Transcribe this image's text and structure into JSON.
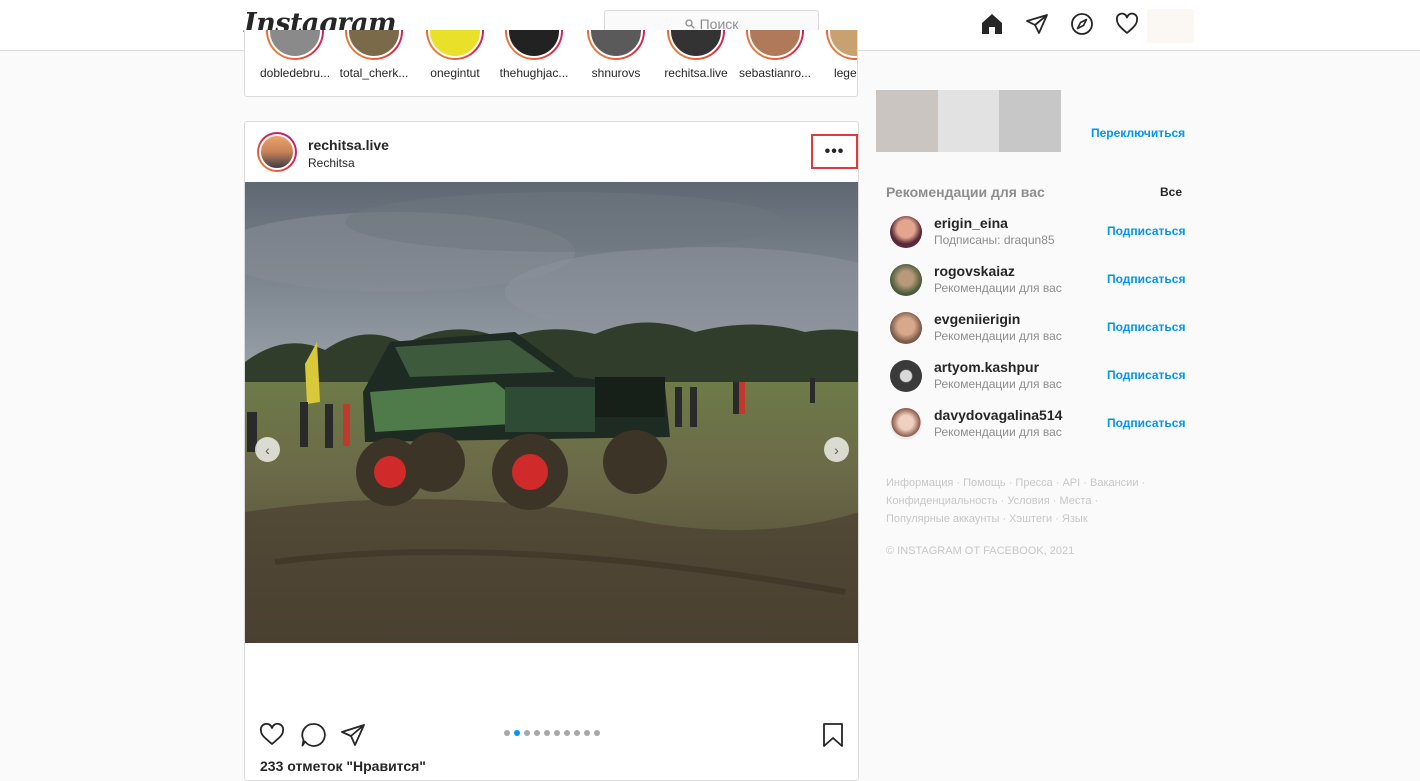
{
  "nav": {
    "logo": "Instagram",
    "search_placeholder": "Поиск",
    "icons": [
      "home-icon",
      "direct-icon",
      "explore-icon",
      "activity-heart-icon"
    ]
  },
  "stories": [
    {
      "username": "dobledebru..."
    },
    {
      "username": "total_cherk..."
    },
    {
      "username": "onegintut"
    },
    {
      "username": "thehughjac..."
    },
    {
      "username": "shnurovs"
    },
    {
      "username": "rechitsa.live"
    },
    {
      "username": "sebastianro..."
    },
    {
      "username": "legends"
    }
  ],
  "post": {
    "username": "rechitsa.live",
    "location": "Rechitsa",
    "more_label": "•••",
    "likes": "233 отметок \"Нравится\"",
    "carousel_count": 10,
    "carousel_active": 1
  },
  "sidebar": {
    "switch_label": "Переключиться",
    "recommendations_title": "Рекомендации для вас",
    "see_all": "Все",
    "suggestions": [
      {
        "username": "erigin_eina",
        "subtitle": "Подписаны: draqun85",
        "follow": "Подписаться"
      },
      {
        "username": "rogovskaiaz",
        "subtitle": "Рекомендации для вас",
        "follow": "Подписаться"
      },
      {
        "username": "evgeniierigin",
        "subtitle": "Рекомендации для вас",
        "follow": "Подписаться"
      },
      {
        "username": "artyom.kashpur",
        "subtitle": "Рекомендации для вас",
        "follow": "Подписаться"
      },
      {
        "username": "davydovagalina514",
        "subtitle": "Рекомендации для вас",
        "follow": "Подписаться"
      }
    ],
    "footer_links": [
      "Информация",
      "Помощь",
      "Пресса",
      "API",
      "Вакансии",
      "Конфиденциальность",
      "Условия",
      "Места",
      "Популярные аккаунты",
      "Хэштеги",
      "Язык"
    ],
    "copyright": "© Instagram от Facebook, 2021"
  },
  "colors": {
    "accent": "#0095f6",
    "highlight_box": "#e0393b"
  }
}
